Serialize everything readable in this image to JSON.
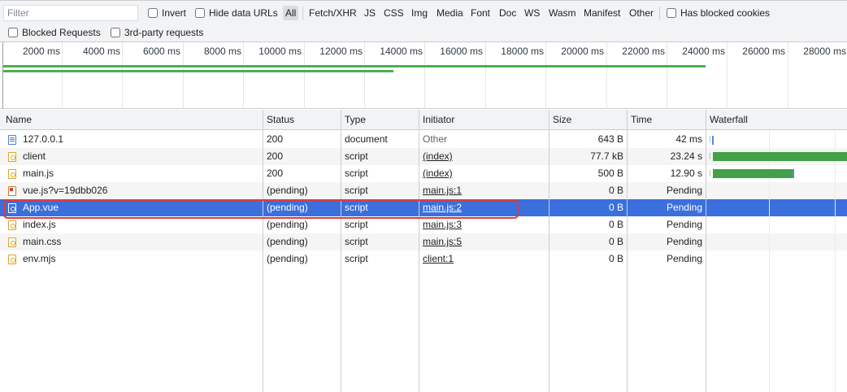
{
  "toolbar": {
    "filter_placeholder": "Filter",
    "invert_label": "Invert",
    "hide_data_urls_label": "Hide data URLs",
    "types": [
      "All",
      "Fetch/XHR",
      "JS",
      "CSS",
      "Img",
      "Media",
      "Font",
      "Doc",
      "WS",
      "Wasm",
      "Manifest",
      "Other"
    ],
    "active_type": "All",
    "has_blocked_cookies_label": "Has blocked cookies",
    "blocked_requests_label": "Blocked Requests",
    "third_party_label": "3rd-party requests"
  },
  "overview": {
    "ticks": [
      "2000 ms",
      "4000 ms",
      "6000 ms",
      "8000 ms",
      "10000 ms",
      "12000 ms",
      "14000 ms",
      "16000 ms",
      "18000 ms",
      "20000 ms",
      "22000 ms",
      "24000 ms",
      "26000 ms",
      "28000 ms"
    ],
    "bar_color": "#4caf50"
  },
  "table": {
    "columns": [
      "Name",
      "Status",
      "Type",
      "Initiator",
      "Size",
      "Time",
      "Waterfall"
    ],
    "rows": [
      {
        "name": "127.0.0.1",
        "icon": "document-icon",
        "status": "200",
        "type": "document",
        "initiator": "Other",
        "initiator_link": false,
        "size": "643 B",
        "time": "42 ms"
      },
      {
        "name": "client",
        "icon": "script-icon",
        "status": "200",
        "type": "script",
        "initiator": "(index)",
        "initiator_link": true,
        "size": "77.7 kB",
        "time": "23.24 s"
      },
      {
        "name": "main.js",
        "icon": "script-icon",
        "status": "200",
        "type": "script",
        "initiator": "(index)",
        "initiator_link": true,
        "size": "500 B",
        "time": "12.90 s"
      },
      {
        "name": "vue.js?v=19dbb026",
        "icon": "image-script-icon",
        "status": "(pending)",
        "type": "script",
        "initiator": "main.js:1",
        "initiator_link": true,
        "size": "0 B",
        "time": "Pending"
      },
      {
        "name": "App.vue",
        "icon": "script-icon",
        "status": "(pending)",
        "type": "script",
        "initiator": "main.js:2",
        "initiator_link": true,
        "size": "0 B",
        "time": "Pending",
        "selected": true
      },
      {
        "name": "index.js",
        "icon": "script-icon",
        "status": "(pending)",
        "type": "script",
        "initiator": "main.js:3",
        "initiator_link": true,
        "size": "0 B",
        "time": "Pending"
      },
      {
        "name": "main.css",
        "icon": "script-icon",
        "status": "(pending)",
        "type": "script",
        "initiator": "main.js:5",
        "initiator_link": true,
        "size": "0 B",
        "time": "Pending"
      },
      {
        "name": "env.mjs",
        "icon": "script-icon",
        "status": "(pending)",
        "type": "script",
        "initiator": "client:1",
        "initiator_link": true,
        "size": "0 B",
        "time": "Pending"
      }
    ]
  },
  "colors": {
    "selected_row": "#3b6fde",
    "highlight_border": "#e53935",
    "waterfall_bar": "#43a047"
  }
}
